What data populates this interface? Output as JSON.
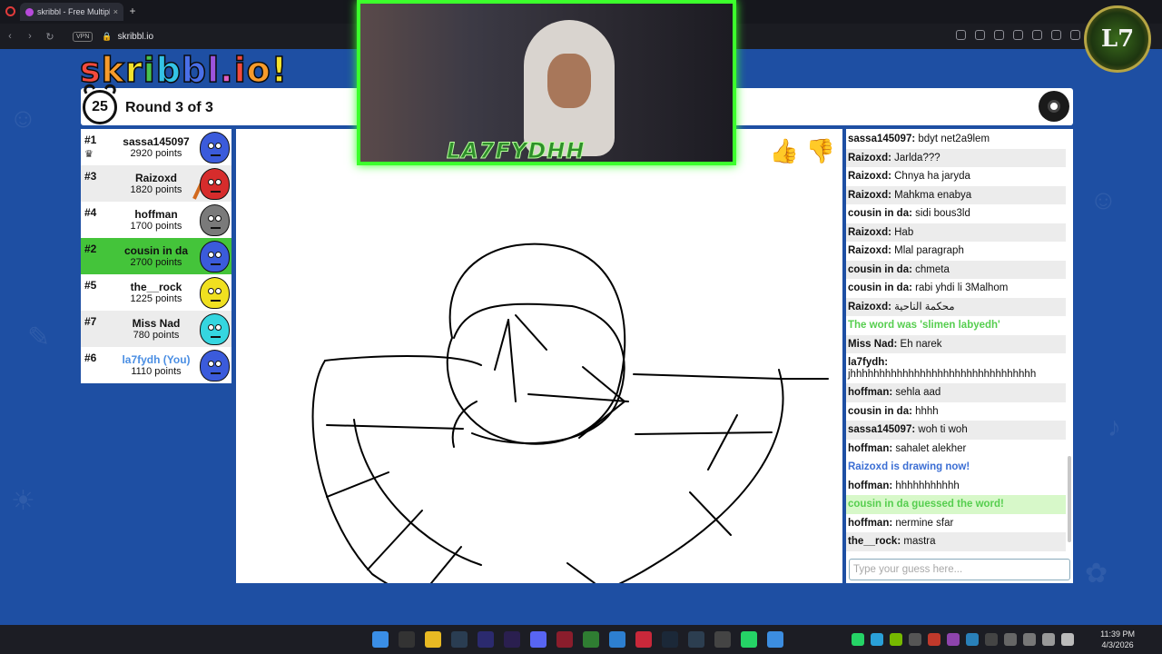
{
  "browser": {
    "tab_title": "skribbl - Free Multiplayer",
    "tab_close": "×",
    "new_tab": "+",
    "vpn_label": "VPN",
    "url": "skribbl.io"
  },
  "header": {
    "logo_text": "skribbl.io!",
    "timer": "25",
    "round_text": "Round 3 of 3"
  },
  "players": [
    {
      "rank": "#1",
      "name": "sassa145097",
      "points": "2920 points",
      "crown": true,
      "color": "#3b5bdb"
    },
    {
      "rank": "#3",
      "name": "Raizoxd",
      "points": "1820 points",
      "drawing": true,
      "color": "#d62c2c"
    },
    {
      "rank": "#4",
      "name": "hoffman",
      "points": "1700 points",
      "color": "#7a7a7a"
    },
    {
      "rank": "#2",
      "name": "cousin in da",
      "points": "2700 points",
      "guessed": true,
      "color": "#3b5bdb"
    },
    {
      "rank": "#5",
      "name": "the__rock",
      "points": "1225 points",
      "color": "#f0e020"
    },
    {
      "rank": "#7",
      "name": "Miss Nad",
      "points": "780 points",
      "color": "#35d6e0"
    },
    {
      "rank": "#6",
      "name": "la7fydh (You)",
      "points": "1110 points",
      "you": true,
      "color": "#3b5bdb"
    }
  ],
  "speech_bubble": "mastra",
  "chat": {
    "messages": [
      {
        "user": "sassa145097:",
        "text": "bdyt net2a9lem"
      },
      {
        "user": "Raizoxd:",
        "text": "Jarlda???"
      },
      {
        "user": "Raizoxd:",
        "text": "Chnya ha jaryda"
      },
      {
        "user": "Raizoxd:",
        "text": "Mahkma enabya"
      },
      {
        "user": "cousin in da:",
        "text": "sidi bous3ld"
      },
      {
        "user": "Raizoxd:",
        "text": "Hab"
      },
      {
        "user": "Raizoxd:",
        "text": "Mlal paragraph"
      },
      {
        "user": "cousin in da:",
        "text": "chmeta"
      },
      {
        "user": "cousin in da:",
        "text": "rabi yhdi li 3Malhom"
      },
      {
        "user": "Raizoxd:",
        "text": "محكمة الناحية"
      },
      {
        "system": "green",
        "text": "The word was 'slimen labyedh'"
      },
      {
        "user": "Miss Nad:",
        "text": "Eh narek"
      },
      {
        "user": "la7fydh:",
        "text": "jhhhhhhhhhhhhhhhhhhhhhhhhhhhhhhhh",
        "wrap": true
      },
      {
        "user": "hoffman:",
        "text": "sehla aad"
      },
      {
        "user": "cousin in da:",
        "text": "hhhh"
      },
      {
        "user": "sassa145097:",
        "text": "woh ti woh"
      },
      {
        "user": "hoffman:",
        "text": "sahalet alekher"
      },
      {
        "system": "blue",
        "text": "Raizoxd is drawing now!"
      },
      {
        "user": "hoffman:",
        "text": "hhhhhhhhhhh"
      },
      {
        "system": "guessed",
        "text": "cousin in da guessed the word!"
      },
      {
        "user": "hoffman:",
        "text": "nermine sfar"
      },
      {
        "user": "the__rock:",
        "text": "mastra"
      }
    ],
    "input_placeholder": "Type your guess here..."
  },
  "overlay": {
    "streamer_name": "LA7FYDHH",
    "badge_text": "L7"
  },
  "taskbar": {
    "time": "11:39 PM",
    "date": "4/3/2026"
  },
  "colors": {
    "page_bg": "#1e4fa3",
    "guessed_green": "#44c43a",
    "webcam_border": "#3cff2c",
    "you_blue": "#4a8ee3"
  }
}
